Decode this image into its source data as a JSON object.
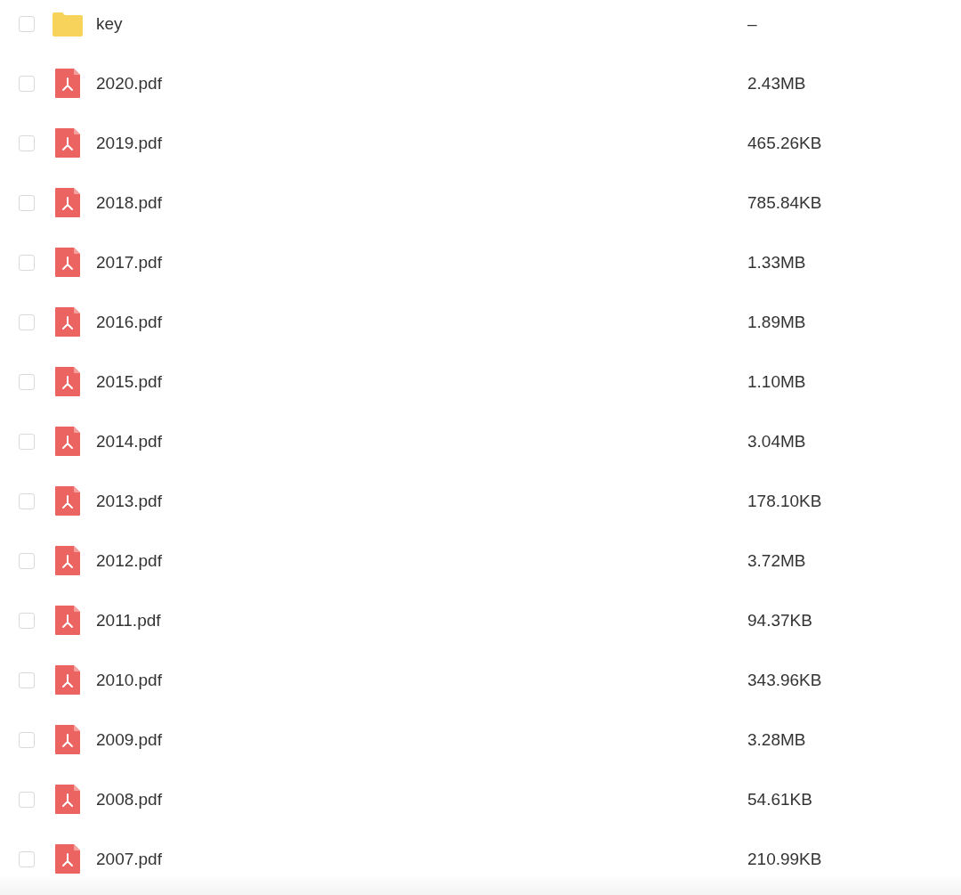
{
  "files": [
    {
      "kind": "folder",
      "name": "key",
      "size": "–",
      "checked": false
    },
    {
      "kind": "pdf",
      "name": "2020.pdf",
      "size": "2.43MB",
      "checked": false
    },
    {
      "kind": "pdf",
      "name": "2019.pdf",
      "size": "465.26KB",
      "checked": false
    },
    {
      "kind": "pdf",
      "name": "2018.pdf",
      "size": "785.84KB",
      "checked": false
    },
    {
      "kind": "pdf",
      "name": "2017.pdf",
      "size": "1.33MB",
      "checked": false
    },
    {
      "kind": "pdf",
      "name": "2016.pdf",
      "size": "1.89MB",
      "checked": false
    },
    {
      "kind": "pdf",
      "name": "2015.pdf",
      "size": "1.10MB",
      "checked": false
    },
    {
      "kind": "pdf",
      "name": "2014.pdf",
      "size": "3.04MB",
      "checked": false
    },
    {
      "kind": "pdf",
      "name": "2013.pdf",
      "size": "178.10KB",
      "checked": false
    },
    {
      "kind": "pdf",
      "name": "2012.pdf",
      "size": "3.72MB",
      "checked": false
    },
    {
      "kind": "pdf",
      "name": "2011.pdf",
      "size": "94.37KB",
      "checked": false
    },
    {
      "kind": "pdf",
      "name": "2010.pdf",
      "size": "343.96KB",
      "checked": false
    },
    {
      "kind": "pdf",
      "name": "2009.pdf",
      "size": "3.28MB",
      "checked": false
    },
    {
      "kind": "pdf",
      "name": "2008.pdf",
      "size": "54.61KB",
      "checked": false
    },
    {
      "kind": "pdf",
      "name": "2007.pdf",
      "size": "210.99KB",
      "checked": false
    }
  ]
}
